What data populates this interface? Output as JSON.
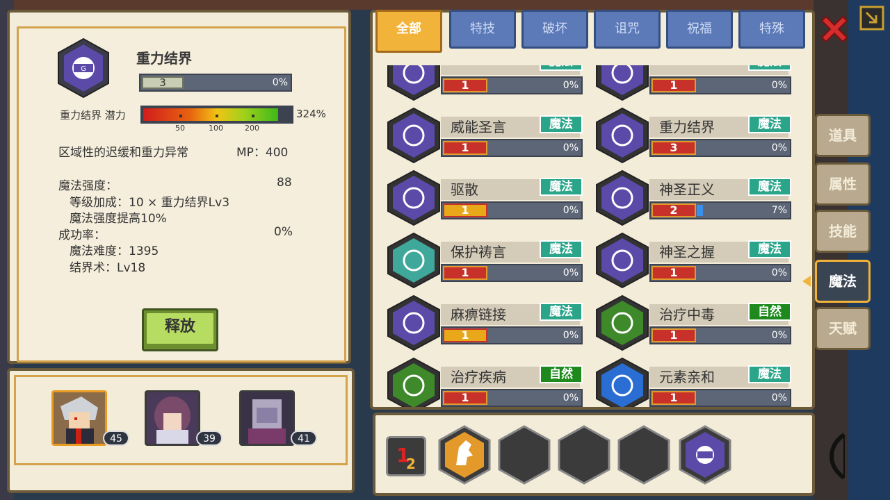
{
  "detail": {
    "name": "重力结界",
    "level": "3",
    "level_pct": "0%",
    "potential_label": "重力结界 潜力",
    "potential_pct": "324%",
    "ticks": [
      "50",
      "100",
      "200"
    ],
    "description": "区域性的迟缓和重力异常",
    "mp": "MP：400",
    "power_label": "魔法强度：",
    "power_value": "88",
    "bonus1": "等级加成：10 × 重力结界Lv3",
    "bonus2": "魔法强度提高10%",
    "success_label": "成功率：",
    "success_value": "0%",
    "difficulty": "魔法难度：1395",
    "school": "结界术：Lv18",
    "release_label": "释放"
  },
  "party": [
    {
      "level": "45"
    },
    {
      "level": "39"
    },
    {
      "level": "41"
    }
  ],
  "tabs": [
    "全部",
    "特技",
    "破坏",
    "诅咒",
    "祝福",
    "特殊"
  ],
  "side_tabs": [
    "道具",
    "属性",
    "技能",
    "魔法",
    "天赋"
  ],
  "skills": [
    {
      "name": "",
      "type": "魔法",
      "level": "1",
      "pct": "0%",
      "fill": 0,
      "icon": "purple-swirl-icon"
    },
    {
      "name": "",
      "type": "魔法",
      "level": "1",
      "pct": "0%",
      "fill": 0,
      "icon": "broken-seal-icon"
    },
    {
      "name": "威能圣言",
      "type": "魔法",
      "level": "1",
      "pct": "0%",
      "fill": 0,
      "icon": "star-burst-icon"
    },
    {
      "name": "重力结界",
      "type": "魔法",
      "level": "3",
      "pct": "0%",
      "fill": 0,
      "icon": "gravity-icon"
    },
    {
      "name": "驱散",
      "type": "魔法",
      "level": "1",
      "pct": "0%",
      "fill": 0,
      "icon": "dispel-icon"
    },
    {
      "name": "神圣正义",
      "type": "魔法",
      "level": "2",
      "pct": "7%",
      "fill": 0.07,
      "icon": "holy-crown-icon"
    },
    {
      "name": "保护祷言",
      "type": "魔法",
      "level": "1",
      "pct": "0%",
      "fill": 0,
      "icon": "heart-shield-icon"
    },
    {
      "name": "神圣之握",
      "type": "魔法",
      "level": "1",
      "pct": "0%",
      "fill": 0,
      "icon": "hand-icon"
    },
    {
      "name": "麻痹链接",
      "type": "魔法",
      "level": "1",
      "pct": "0%",
      "fill": 0,
      "icon": "chain-nodes-icon"
    },
    {
      "name": "治疗中毒",
      "type": "自然",
      "level": "1",
      "pct": "0%",
      "fill": 0,
      "icon": "skull-icon"
    },
    {
      "name": "治疗疾病",
      "type": "自然",
      "level": "1",
      "pct": "0%",
      "fill": 0,
      "icon": "syringe-icon"
    },
    {
      "name": "元素亲和",
      "type": "魔法",
      "level": "1",
      "pct": "0%",
      "fill": 0,
      "icon": "water-drops-icon"
    }
  ],
  "colors": {
    "magic": "#2aa58a",
    "nature": "#1e8a1e",
    "accent": "#f2b33a"
  }
}
